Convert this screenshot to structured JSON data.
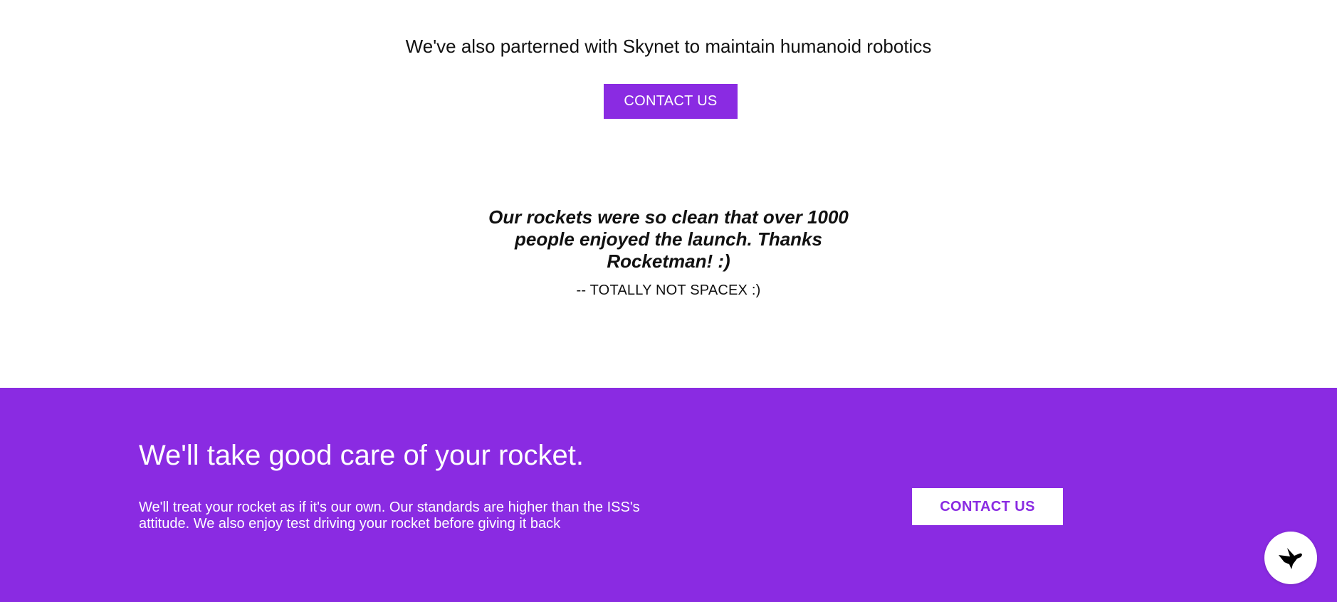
{
  "partner": {
    "text": "We've also parterned with Skynet to maintain humanoid robotics",
    "contact_label": "CONTACT US"
  },
  "testimonial": {
    "quote": "Our rockets were so clean that over 1000 people enjoyed the launch. Thanks Rocketman! :)",
    "author": "-- TOTALLY NOT SPACEX :)"
  },
  "cta": {
    "heading": "We'll take good care of your rocket.",
    "body": "We'll treat your rocket as if it's our own. Our standards are higher than the ISS's attitude. We also enjoy test driving your rocket before giving it back",
    "contact_label": "CONTACT US"
  },
  "chat_widget": {
    "icon": "bird-icon"
  },
  "colors": {
    "accent": "#8a2be2",
    "text": "#111111",
    "background": "#ffffff"
  }
}
